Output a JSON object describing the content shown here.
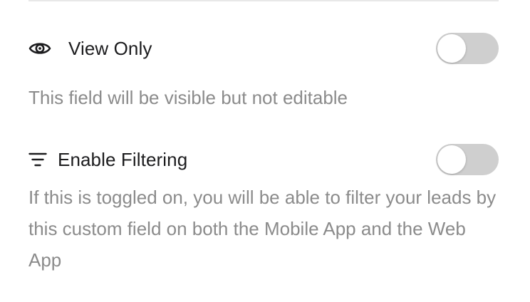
{
  "settings": [
    {
      "icon": "eye-icon",
      "label": "View Only",
      "description": "This field will be visible but not editable",
      "toggle_on": false
    },
    {
      "icon": "filter-icon",
      "label": "Enable Filtering",
      "description": "If this is toggled on, you will be able to filter your leads by this custom field on both the Mobile App and the Web App",
      "toggle_on": false
    }
  ],
  "colors": {
    "label_text": "#1c1c1e",
    "description_text": "#8b8b8b",
    "toggle_off_track": "#cfcfcf",
    "toggle_knob": "#ffffff",
    "divider": "#e8e8e8"
  }
}
